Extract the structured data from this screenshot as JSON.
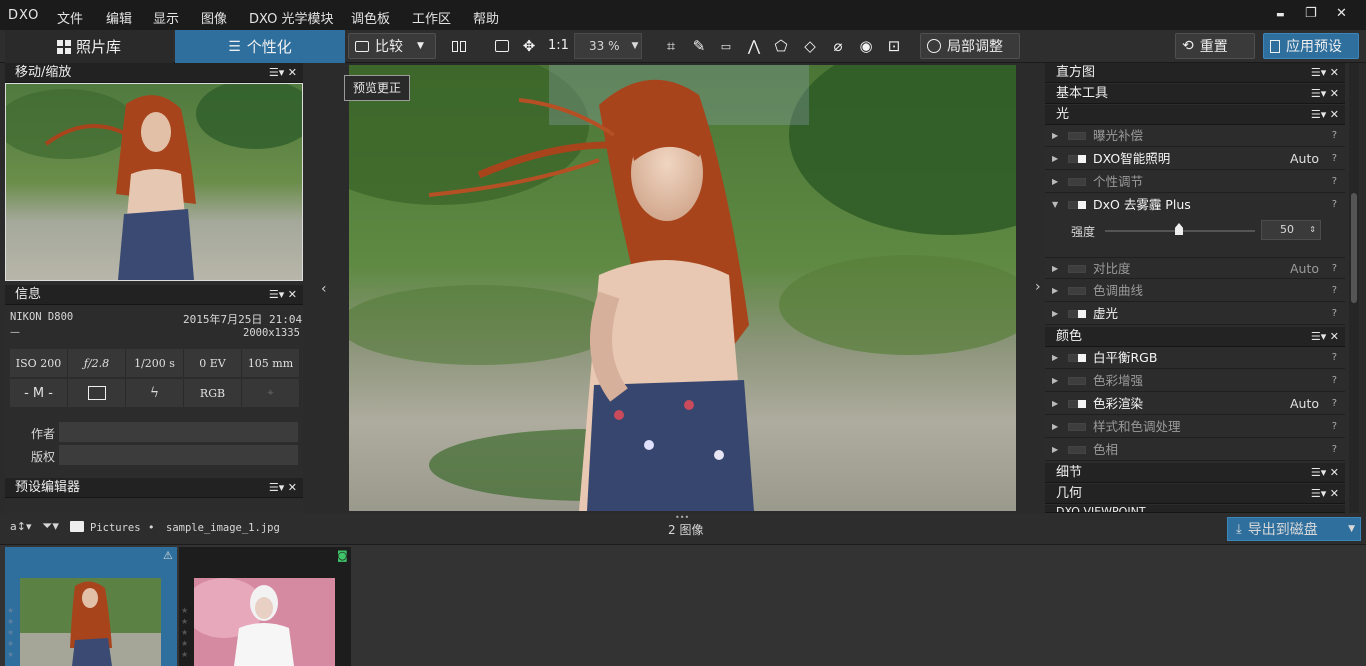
{
  "app": {
    "logo": "DXO"
  },
  "menu": [
    "文件",
    "编辑",
    "显示",
    "图像",
    "DXO 光学模块",
    "调色板",
    "工作区",
    "帮助"
  ],
  "window_controls": {
    "minimize": "▬",
    "restore": "❐",
    "close": "✕"
  },
  "tabs": {
    "library": "照片库",
    "customize": "个性化"
  },
  "toolbar": {
    "compare": "比较",
    "ratio": "1:1",
    "zoom": "33 %",
    "local_adjust": "局部调整",
    "reset": "重置",
    "apply_preset": "应用预设"
  },
  "left": {
    "nav_title": "移动/缩放",
    "info_title": "信息",
    "camera": "NIKON D800",
    "date": "2015年7月25日 21:04",
    "dash": "—",
    "dimensions": "2000x1335",
    "exif": [
      "ISO 200",
      "ƒ/2.8",
      "1/200 s",
      "0 EV",
      "105 mm"
    ],
    "exif2": [
      "- M -",
      "",
      "",
      "RGB",
      ""
    ],
    "author_label": "作者",
    "copyright_label": "版权",
    "preset_editor_title": "预设编辑器"
  },
  "center": {
    "preview_label": "预览更正"
  },
  "right": {
    "histogram": "直方图",
    "basic_tools": "基本工具",
    "light": "光",
    "color": "颜色",
    "detail": "细节",
    "geometry": "几何",
    "viewpoint": "DXO VIEWPOINT",
    "light_items": [
      {
        "label": "曝光补偿",
        "value": "",
        "q": "?"
      },
      {
        "label": "DXO智能照明",
        "value": "Auto",
        "q": "?"
      },
      {
        "label": "个性调节",
        "value": "",
        "q": "?"
      },
      {
        "label": "DxO 去雾霾 Plus",
        "value": "",
        "q": "?"
      },
      {
        "label": "对比度",
        "value": "Auto",
        "q": "?"
      },
      {
        "label": "色调曲线",
        "value": "",
        "q": "?"
      },
      {
        "label": "虚光",
        "value": "",
        "q": "?"
      }
    ],
    "strength_label": "强度",
    "strength_value": "50",
    "strength_fraction": 0.5,
    "color_items": [
      {
        "label": "白平衡RGB",
        "value": "",
        "q": "?"
      },
      {
        "label": "色彩增强",
        "value": "",
        "q": "?"
      },
      {
        "label": "色彩渲染",
        "value": "Auto",
        "q": "?"
      },
      {
        "label": "样式和色调处理",
        "value": "",
        "q": "?"
      },
      {
        "label": "色相",
        "value": "",
        "q": "?"
      }
    ]
  },
  "strip": {
    "folder": "Pictures",
    "sep": "•",
    "filename": "sample_image_1.jpg",
    "count": "2 图像",
    "export": "导出到磁盘"
  },
  "colors": {
    "accent": "#2e6f9e",
    "hair": "#a8441c"
  }
}
